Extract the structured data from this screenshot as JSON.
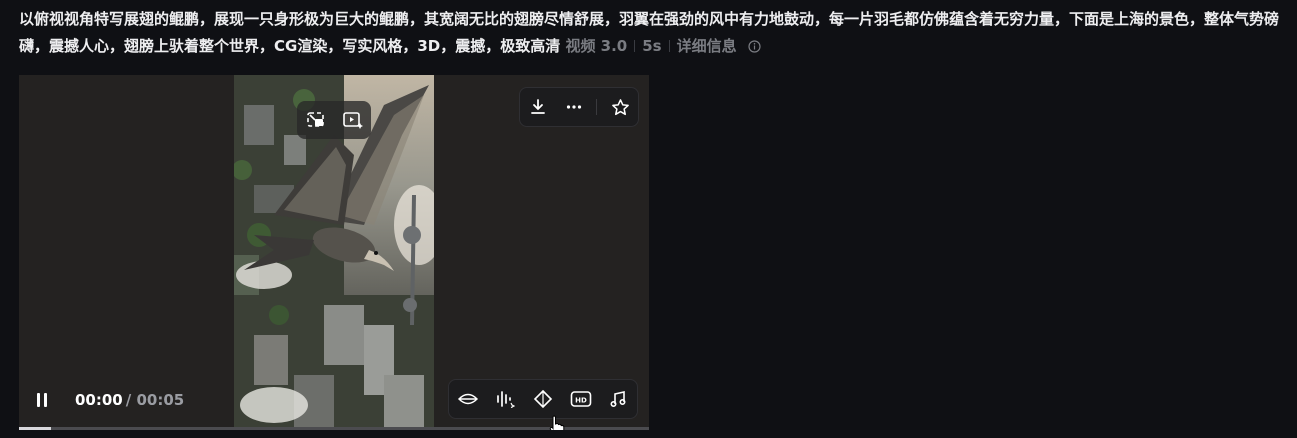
{
  "prompt": {
    "text": "以俯视视角特写展翅的鲲鹏，展现一只身形极为巨大的鲲鹏，其宽阔无比的翅膀尽情舒展，羽翼在强劲的风中有力地鼓动，每一片羽毛都仿佛蕴含着无穷力量，下面是上海的景色，整体气势磅礴，震撼人心，翅膀上驮着整个世界，CG渲染，写实风格，3D，震撼，极致高清",
    "model": "视频 3.0",
    "duration": "5s",
    "details_label": "详细信息"
  },
  "player": {
    "current_time": "00:00",
    "total_time": "/ 00:05",
    "progress": 0.05,
    "pip_tools": [
      "picture-in-picture-icon",
      "video-spark-icon"
    ],
    "top_tools": [
      "download-icon",
      "more-icon",
      "star-icon"
    ],
    "bottom_tools": [
      "lip-sync-icon",
      "audio-wave-icon",
      "frame-interpolation-icon",
      "hd-icon",
      "music-icon"
    ]
  },
  "colors": {
    "background": "#0f1014",
    "player_bg": "#242221",
    "meta_text": "#7a7c82"
  }
}
